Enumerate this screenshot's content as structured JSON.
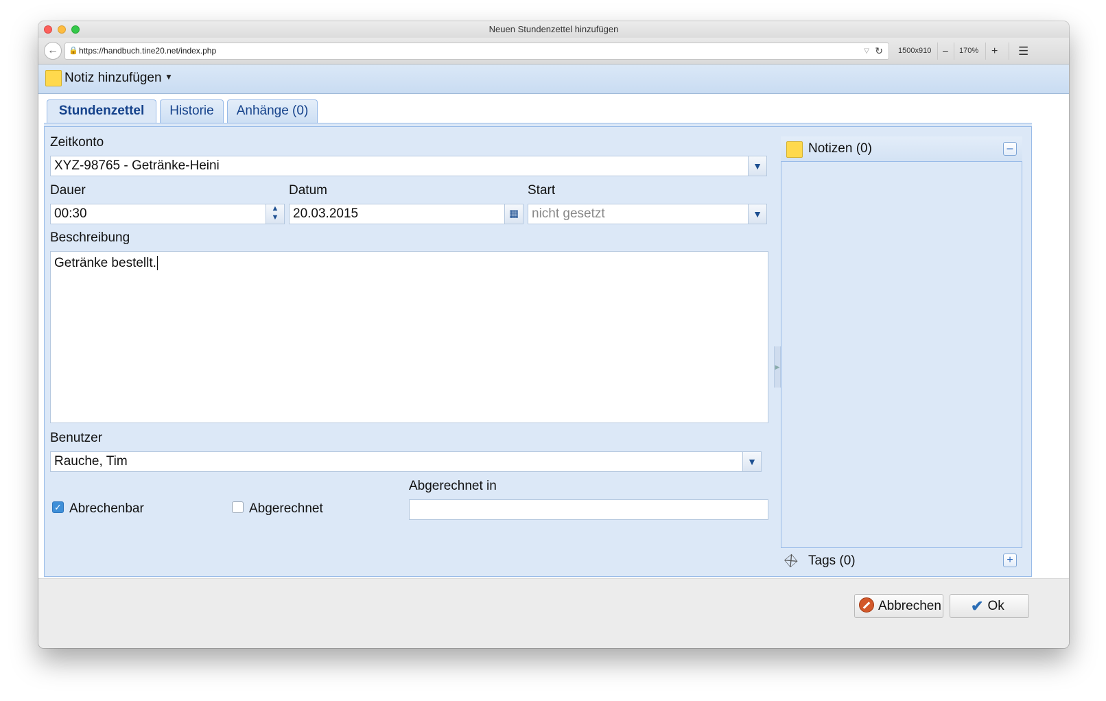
{
  "window": {
    "title": "Neuen Stundenzettel hinzufügen"
  },
  "browser": {
    "url": "https://handbuch.tine20.net/index.php",
    "resolution": "1500x910",
    "zoom_out": "–",
    "zoom": "170%",
    "zoom_in": "+",
    "menu_icon": "hamburger-icon"
  },
  "toolbar": {
    "add_note_label": "Notiz hinzufügen"
  },
  "tabs": [
    {
      "label": "Stundenzettel",
      "active": true
    },
    {
      "label": "Historie",
      "active": false
    },
    {
      "label": "Anhänge (0)",
      "active": false
    }
  ],
  "form": {
    "zeitkonto": {
      "label": "Zeitkonto",
      "value": "XYZ-98765 - Getränke-Heini"
    },
    "dauer": {
      "label": "Dauer",
      "value": "00:30"
    },
    "datum": {
      "label": "Datum",
      "value": "20.03.2015"
    },
    "start": {
      "label": "Start",
      "placeholder": "nicht gesetzt"
    },
    "beschreibung": {
      "label": "Beschreibung",
      "value": "Getränke bestellt."
    },
    "benutzer": {
      "label": "Benutzer",
      "value": "Rauche, Tim"
    },
    "abrechenbar": {
      "label": "Abrechenbar",
      "checked": true
    },
    "abgerechnet": {
      "label": "Abgerechnet",
      "checked": false
    },
    "abgerechnet_in": {
      "label": "Abgerechnet in",
      "value": ""
    }
  },
  "sidebar": {
    "notes_title": "Notizen (0)",
    "tags_title": "Tags (0)"
  },
  "footer": {
    "cancel_label": "Abbrechen",
    "ok_label": "Ok"
  },
  "colors": {
    "panel_bg": "#dce8f7",
    "border": "#99bbe8",
    "tab_text": "#15428b"
  }
}
